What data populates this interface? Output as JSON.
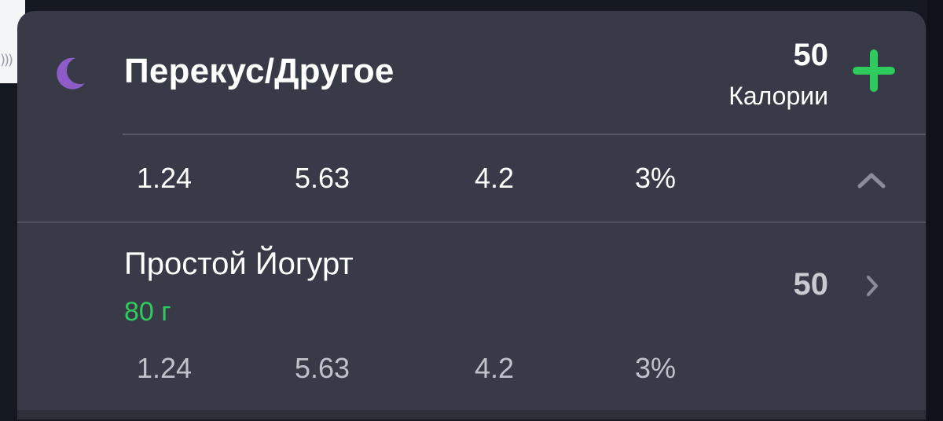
{
  "colors": {
    "card_bg": "#383b47",
    "accent_green": "#2ecc5c",
    "moon_purple": "#8e5cc8"
  },
  "meal": {
    "icon": "moon-icon",
    "title": "Перекус/Другое",
    "calories": "50",
    "calories_label": "Калории",
    "add_icon": "plus-icon",
    "summary": {
      "values": [
        "1.24",
        "5.63",
        "4.2",
        "3%"
      ],
      "collapse_icon": "chevron-up-icon"
    }
  },
  "items": [
    {
      "name": "Простой Йогурт",
      "amount": "80 г",
      "calories": "50",
      "values": [
        "1.24",
        "5.63",
        "4.2",
        "3%"
      ],
      "open_icon": "chevron-right-icon"
    }
  ]
}
